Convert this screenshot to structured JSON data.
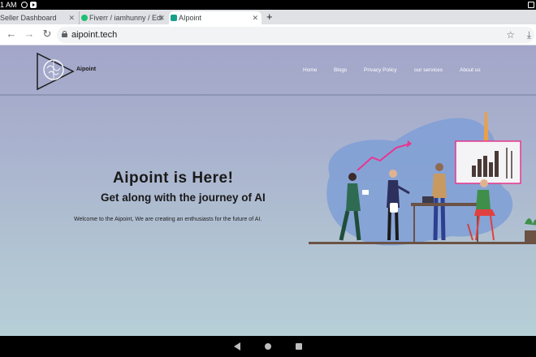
{
  "status_bar": {
    "time": "1 AM"
  },
  "tabs": [
    {
      "label": "Seller Dashboard"
    },
    {
      "label": "Fiverr / iamhunny / Edi"
    },
    {
      "label": "AIpoint"
    }
  ],
  "toolbar": {
    "url": "aipoint.tech"
  },
  "site": {
    "logo_text": "Aipoint",
    "nav": [
      "Home",
      "Blogs",
      "Privacy Policy",
      "our services",
      "About us"
    ],
    "hero_title": "Aipoint is Here!",
    "hero_subtitle": "Get along with the journey of AI",
    "hero_description": "Welcome to the Aipoint, We are creating an enthusiasts for the future of AI."
  },
  "colors": {
    "accent_pink": "#e8368f",
    "blob_blue": "#7f9fd6",
    "floor_brown": "#6b5245"
  }
}
